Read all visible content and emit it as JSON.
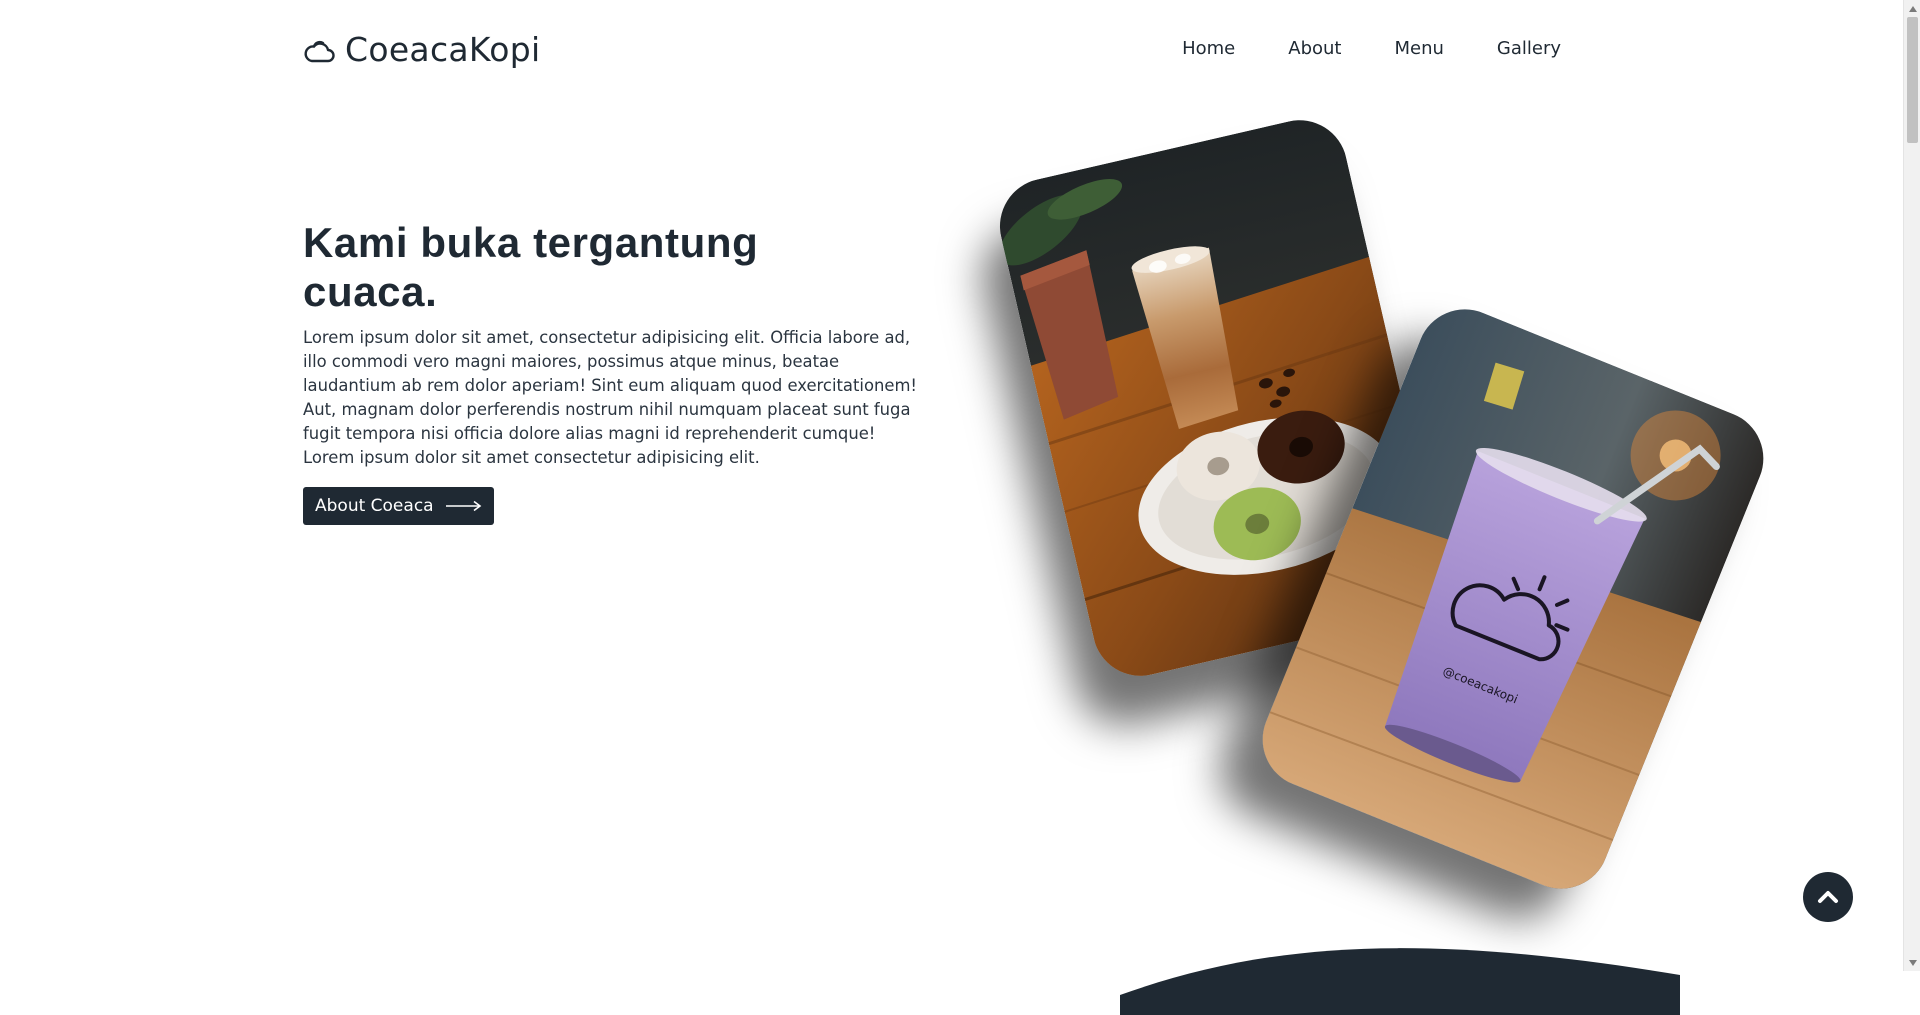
{
  "brand": {
    "name": "CoeacaKopi",
    "icon": "cloud-icon"
  },
  "nav": {
    "items": [
      {
        "label": "Home"
      },
      {
        "label": "About"
      },
      {
        "label": "Menu"
      },
      {
        "label": "Gallery"
      }
    ]
  },
  "hero": {
    "title": "Kami buka tergantung cuaca.",
    "text": "Lorem ipsum dolor sit amet, consectetur adipisicing elit. Officia labore ad, illo commodi vero magni maiores, possimus atque minus, beatae laudantium ab rem dolor aperiam! Sint eum aliquam quod exercitationem! Aut, magnam dolor perferendis nostrum nihil numquam placeat sunt fuga fugit tempora nisi officia dolore alias magni id reprehenderit cumque! Lorem ipsum dolor sit amet consectetur adipisicing elit.",
    "button_label": "About Coeaca",
    "button_icon": "long-arrow-right-icon"
  },
  "photos": {
    "photo1": "iced coffee latte with donuts on wooden table",
    "photo2": "purple iced drink in cup with cloud logo",
    "cup_label": "@coeacakopi"
  },
  "scroll_top": {
    "icon": "chevron-up-icon"
  },
  "colors": {
    "primary_dark": "#1f2933",
    "background": "#ffffff",
    "text": "#2b3540"
  }
}
